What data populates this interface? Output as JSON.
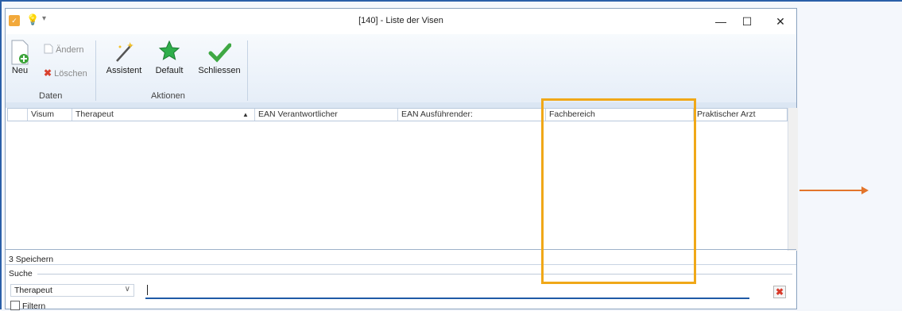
{
  "window": {
    "title": "[140] - Liste der Visen",
    "minimize_label": "—",
    "maximize_label": "☐",
    "close_label": "✕"
  },
  "ribbon": {
    "neu_label": "Neu",
    "aendern_label": "Ändern",
    "loeschen_label": "Löschen",
    "daten_group": "Daten",
    "assistent_label": "Assistent",
    "default_label": "Default",
    "schliessen_label": "Schliessen",
    "aktionen_group": "Aktionen"
  },
  "grid": {
    "columns": [
      "Visum",
      "Therapeut",
      "EAN Verantwortlicher",
      "EAN Ausführender:",
      "Fachbereich",
      "Praktischer Arzt"
    ],
    "sorted_column": "Therapeut",
    "sort_indicator": "▲"
  },
  "status": {
    "text": "3 Speichern"
  },
  "search": {
    "section_label": "Suche",
    "field_select_value": "Therapeut",
    "query_value": "",
    "filter_label": "Filtern"
  },
  "colors": {
    "highlight": "#f0a818",
    "arrow": "#e3752b"
  }
}
